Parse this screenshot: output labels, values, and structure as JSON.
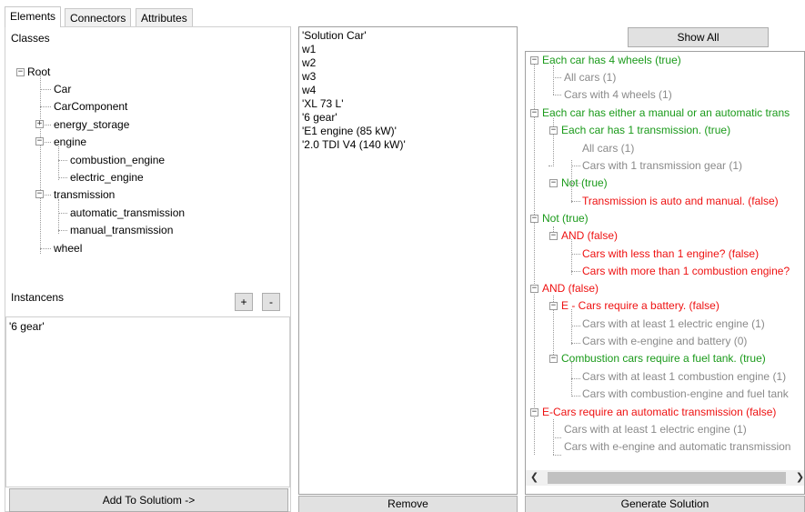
{
  "tabs": [
    "Elements",
    "Connectors",
    "Attributes"
  ],
  "classes_label": "Classes",
  "class_tree": {
    "root": "Root",
    "items": [
      "Car",
      "CarComponent",
      "energy_storage",
      "engine",
      "combustion_engine",
      "electric_engine",
      "transmission",
      "automatic_transmission",
      "manual_transmission",
      "wheel"
    ]
  },
  "instances": {
    "label": "Instancens",
    "add_label": "+",
    "remove_label": "-",
    "items": [
      "'6 gear'"
    ]
  },
  "add_to_solution_label": "Add To Solutiom ->",
  "solution_list": [
    "'Solution Car'",
    "w1",
    "w2",
    "w3",
    "w4",
    "'XL 73 L'",
    "'6 gear'",
    "'E1 engine (85 kW)'",
    "'2.0 TDI V4 (140 kW)'"
  ],
  "remove_label": "Remove",
  "show_all_label": "Show All",
  "generate_label": "Generate Solution",
  "constraints": [
    "Each car has 4 wheels (true)",
    "All cars (1)",
    "Cars with 4 wheels (1)",
    "Each car has either a manual or an automatic trans",
    "Each car has 1 transmission. (true)",
    "All cars (1)",
    "Cars with 1 transmission gear (1)",
    "Not (true)",
    "Transmission is auto and manual. (false)",
    "Not (true)",
    "AND (false)",
    "Cars with less than 1 engine? (false)",
    "Cars with more than 1 combustion engine?",
    "AND (false)",
    "E - Cars require a battery. (false)",
    "Cars with at least 1 electric engine (1)",
    "Cars with e-engine and battery (0)",
    "Combustion cars require a fuel tank. (true)",
    "Cars with at least 1 combustion engine (1)",
    "Cars with combustion-engine and fuel tank",
    "E-Cars require an automatic transmission (false)",
    "Cars with at least 1 electric engine (1)",
    "Cars with e-engine and automatic transmission"
  ],
  "colors": {
    "true": "#1a9a1a",
    "false": "#ee1111",
    "neutral": "#8a8a8a"
  }
}
